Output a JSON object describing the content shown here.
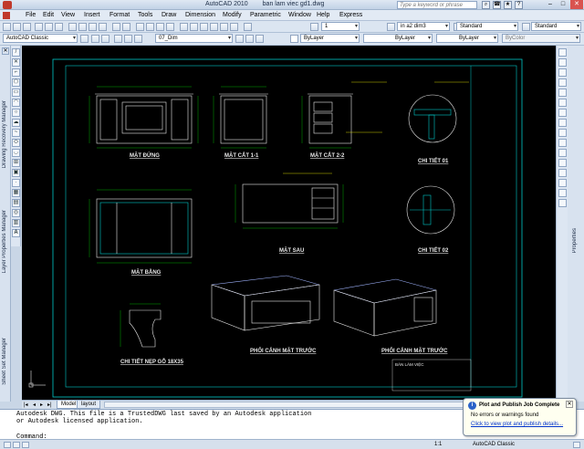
{
  "window": {
    "app_title": "AutoCAD 2010",
    "doc_title": "ban lam viec gd1.dwg",
    "search_placeholder": "Type a keyword or phrase"
  },
  "menu": [
    "File",
    "Edit",
    "View",
    "Insert",
    "Format",
    "Tools",
    "Draw",
    "Dimension",
    "Modify",
    "Parametric",
    "Window",
    "Help",
    "Express"
  ],
  "toolbar1": {
    "scale_combo": "1",
    "dimstyle_combo": "in a2 dim3",
    "textstyle_combo": "Standard",
    "tablestyle_combo": "Standard"
  },
  "toolbar2": {
    "workspace": "AutoCAD Classic",
    "layer": "07_Dim",
    "color": "ByLayer",
    "linetype": "ByLayer",
    "lineweight": "ByLayer",
    "plotstyle": "ByColor"
  },
  "left_palettes": [
    "Sheet Set Manager",
    "Layer Properties Manager",
    "Drawing Recovery Manager"
  ],
  "right_palettes": [
    "Properties"
  ],
  "layout_tabs": [
    "Model",
    "layout"
  ],
  "command_history": [
    "Autodesk DWG.  This file is a TrustedDWG last saved by an Autodesk application",
    "or Autodesk licensed application."
  ],
  "command_prompt": "Command:",
  "notification": {
    "title": "Plot and Publish Job Complete",
    "message": "No errors or warnings found",
    "link": "Click to view plot and publish details..."
  },
  "status": {
    "scale": "1:1",
    "workspace": "AutoCAD Classic"
  },
  "drawing_labels": {
    "mat_dung": "MẶT ĐỨNG",
    "mat_cat_11": "MẶT CẮT 1-1",
    "mat_cat_22": "MẶT CẮT 2-2",
    "chi_tiet_01": "CHI TIẾT 01",
    "mat_bang": "MẶT BẰNG",
    "mat_sau": "MẶT SAU",
    "chi_tiet_02": "CHI TIẾT 02",
    "chi_tiet_nep": "CHI TIẾT NẸP GỖ 18X35",
    "phoi_canh_truoc": "PHỐI CẢNH MẶT TRƯỚC",
    "phoi_canh_truoc_2": "PHỐI CẢNH MẶT TRƯỚC",
    "table_title": "BÀN LÀM VIỆC"
  },
  "colors": {
    "model_bg": "#000000",
    "frame": "#00c8c8",
    "geometry": "#e8e8e8",
    "dimension": "#00d000",
    "annotation": "#ffff00"
  }
}
